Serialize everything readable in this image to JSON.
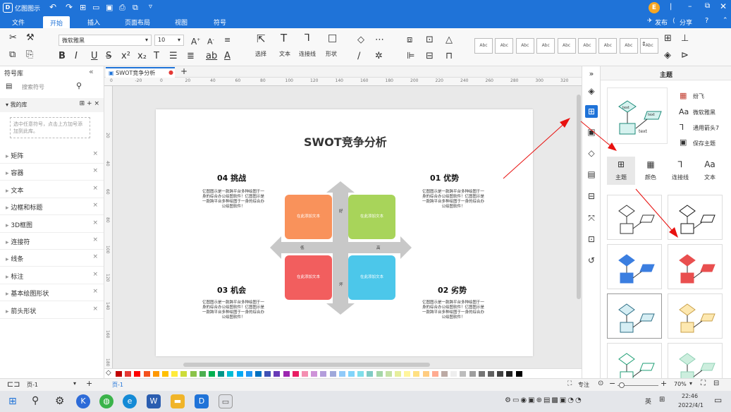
{
  "app": {
    "title": "亿图图示",
    "user_avatar": "E",
    "header_actions": [
      "发布",
      "分享"
    ],
    "menu_tabs": [
      "文件",
      "开始",
      "插入",
      "页面布局",
      "视图",
      "符号"
    ],
    "active_tab": "开始"
  },
  "ribbon": {
    "font_family": "微软雅黑",
    "font_size": "10",
    "tool_labels": [
      "选择",
      "文本",
      "连接线",
      "形状"
    ],
    "style_swatch_label": "Abc"
  },
  "left_panel": {
    "title": "符号库",
    "search_placeholder": "搜索符号",
    "my_library": "我的库",
    "my_library_hint": "选中任意符号，点击上方加号添加到此库。",
    "items": [
      "矩阵",
      "容器",
      "文本",
      "边框和标题",
      "3D框图",
      "连接符",
      "线条",
      "标注",
      "基本绘图形状",
      "箭头形状"
    ]
  },
  "document": {
    "tab_name": "SWOT竞争分析",
    "ruler_top": [
      "0",
      "-20",
      "0",
      "20",
      "40",
      "60",
      "80",
      "100",
      "120",
      "140",
      "160",
      "180",
      "200",
      "220",
      "240",
      "260",
      "280",
      "300",
      "320"
    ],
    "ruler_left": [
      "20",
      "40",
      "60",
      "80",
      "100",
      "120",
      "140",
      "160",
      "180"
    ],
    "diagram_title": "SWOT竞争分析",
    "quadrants": [
      {
        "heading": "04 挑战",
        "body": "亿图图示是一款跨平台多种绘图于一身的综合办公绘图软件！亿图图示是一款跨平台多种绘图于一身的综合办公绘图软件！",
        "box_text": "在此添加文本",
        "color": "#f9925b"
      },
      {
        "heading": "01 优势",
        "body": "亿图图示是一款跨平台多种绘图于一身的综合办公绘图软件！亿图图示是一款跨平台多种绘图于一身的综合办公绘图软件！",
        "box_text": "在此添加文本",
        "color": "#a8d45a"
      },
      {
        "heading": "03 机会",
        "body": "亿图图示是一款跨平台多种绘图于一身的综合办公绘图软件！亿图图示是一款跨平台多种绘图于一身的综合办公绘图软件！",
        "box_text": "在此添加文本",
        "color": "#f25e5e"
      },
      {
        "heading": "02 劣势",
        "body": "亿图图示是一款跨平台多种绘图于一身的综合办公绘图软件！亿图图示是一款跨平台多种绘图于一身的综合办公绘图软件！",
        "box_text": "在此添加文本",
        "color": "#4cc7ea"
      }
    ],
    "axis_labels": {
      "top": "好",
      "left": "低",
      "right": "高",
      "bottom": "坏"
    }
  },
  "right_panel": {
    "title": "主题",
    "options": [
      "纷飞",
      "微软雅黑",
      "通用箭头7",
      "保存主题"
    ],
    "preview_labels": [
      "text",
      "text",
      "text"
    ],
    "tabs": [
      "主题",
      "颜色",
      "连接线",
      "文本"
    ],
    "active_tab": "主题"
  },
  "status": {
    "page_selector": "页-1",
    "page_tab": "页-1",
    "focus_label": "专注",
    "zoom": "70%"
  },
  "taskbar": {
    "time": "22:46",
    "date": "2022/4/1",
    "ime": "英"
  },
  "palette_colors": [
    "#c00000",
    "#e53935",
    "#ff0000",
    "#f4511e",
    "#ff9800",
    "#ffc000",
    "#ffeb3b",
    "#cddc39",
    "#8bc34a",
    "#4caf50",
    "#00b050",
    "#009688",
    "#00bcd4",
    "#03a9f4",
    "#2196f3",
    "#0070c0",
    "#3f51b5",
    "#673ab7",
    "#9c27b0",
    "#e91e63",
    "#f48fb1",
    "#ce93d8",
    "#b39ddb",
    "#9fa8da",
    "#90caf9",
    "#81d4fa",
    "#80deea",
    "#80cbc4",
    "#a5d6a7",
    "#c5e1a5",
    "#e6ee9c",
    "#fff59d",
    "#ffe082",
    "#ffcc80",
    "#ffab91",
    "#bcaaa4",
    "#eeeeee",
    "#bdbdbd",
    "#9e9e9e",
    "#757575",
    "#616161",
    "#424242",
    "#212121",
    "#000000"
  ]
}
